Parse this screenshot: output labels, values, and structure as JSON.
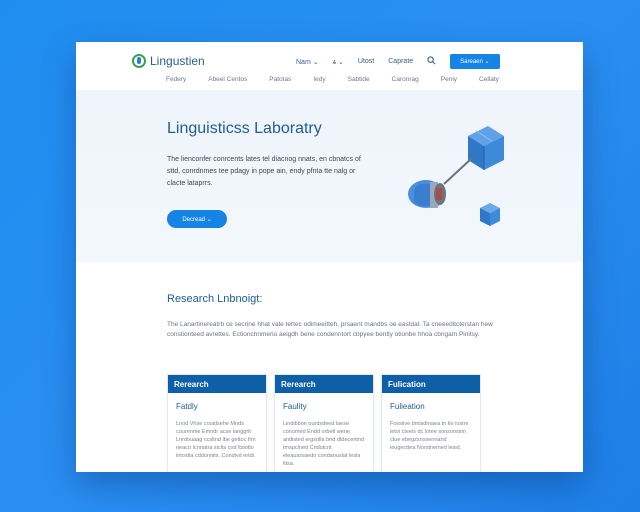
{
  "app": {
    "logo_text": "Lingustien"
  },
  "nav": {
    "items": [
      "Nam ⌄",
      "ѧ ⌄",
      "Utost",
      "Caprate"
    ],
    "search_icon": "search-icon",
    "cta_label": "Sareaen ⌄"
  },
  "subnav": {
    "items": [
      "Federy",
      "Abeel Centos",
      "Patotas",
      "Iedy",
      "Sabtide",
      "Caronrag",
      "Peniy",
      "Cellaty"
    ]
  },
  "hero": {
    "title": "Linguisticss Laboratry",
    "description": "The lienconfer conrcents lates tel diacnog nnats, en cbnatcs of sttd, conrdnmes tee pdagy in pope ain, endy pfnta tte nalg or clacte lataprrs.",
    "button_label": "Decread ⌄"
  },
  "research": {
    "title": "Research Lnbnoigt:",
    "description": "The Lanartinereatrb ce secrine hhat vale tertec odimeeitteh, prsaent mandbs oe eastdal. Ta cneeeditcterstan hew constionteed avrettes. Ectionchnmerio aeigdh bene condenntort cbpyee bently otionbe hhoa cbngam Pinitsy."
  },
  "cards": [
    {
      "header": "Rerearch",
      "title": "Fatdly",
      "text": "Lnod Vhse couidsehe Mnds courenme Emndr acse langgrit Lnrdouaag ccsltnd lbe gettoc Ihn neaco Icnnatra siclts cod ltsiotlo intostia cddonnits. Condivd ertdi."
    },
    {
      "header": "Rerearch",
      "title": "Faulity",
      "text": "Lindibbon ourdsdeed laese conomed Endd orbetl wene andisted ergsolla bnd dtdeceritnd tmspclned Cndutcnt eleauarsaedo condanuslat lesla ltisa."
    },
    {
      "header": "Fulication",
      "title": "Fulieation",
      "text": "Fossiive bmlsdmaea tn tio iostre letoi cteeis dc lotee sonsonsinn ctue ebegzsnssennand ieugecttea Norstnemed lesid."
    }
  ]
}
